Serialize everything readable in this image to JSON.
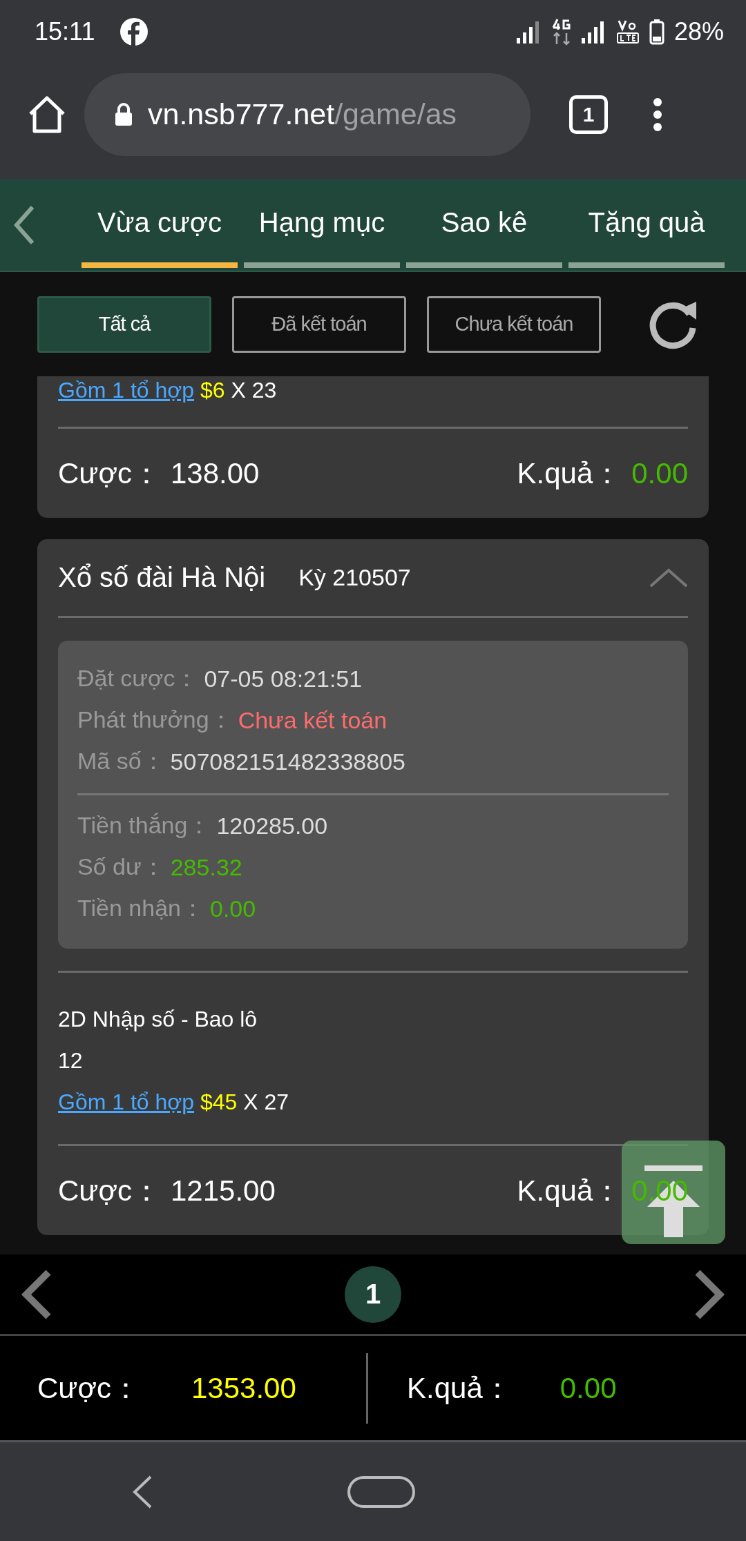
{
  "status_bar": {
    "time": "15:11",
    "battery": "28%"
  },
  "browser": {
    "url_host": "vn.nsb777.net",
    "url_path": "/game/as",
    "tab_count": "1"
  },
  "tabs": [
    {
      "label": "Vừa cược",
      "selected": true
    },
    {
      "label": "Hạng mục",
      "selected": false
    },
    {
      "label": "Sao kê",
      "selected": false
    },
    {
      "label": "Tặng quà",
      "selected": false
    }
  ],
  "filters": [
    {
      "label": "Tất cả",
      "selected": true
    },
    {
      "label": "Đã kết toán",
      "selected": false
    },
    {
      "label": "Chưa kết toán",
      "selected": false
    }
  ],
  "cards": [
    {
      "kind": "partial",
      "combo_link": "Gồm 1 tổ hợp",
      "stake": "$6",
      "multiplier": "X 23",
      "bet_label": "Cược：",
      "bet": "138.00",
      "result_label": "K.quả：",
      "result": "0.00"
    },
    {
      "kind": "full",
      "title": "Xổ số đài Hà Nội",
      "period": "Kỳ 210507",
      "expanded": true,
      "details": [
        [
          {
            "label": "Đặt cược：",
            "value": "07-05 08:21:51",
            "color": "#dddddd"
          },
          {
            "label": "Phát thưởng：",
            "value": "Chưa kết toán",
            "color": "#ff6b6b"
          },
          {
            "label": "Mã số：",
            "value": "507082151482338805",
            "color": "#dddddd"
          }
        ],
        [
          {
            "label": "Tiền thắng：",
            "value": "120285.00",
            "color": "#dddddd"
          },
          {
            "label": "Số dư：",
            "value": "285.32",
            "color": "#44bb00"
          },
          {
            "label": "Tiền nhận：",
            "value": "0.00",
            "color": "#44bb00"
          }
        ]
      ],
      "game": "2D Nhập số - Bao lô",
      "numbers": "12",
      "combo_link": "Gồm 1 tổ hợp",
      "stake": "$45",
      "multiplier": "X 27",
      "bet_label": "Cược：",
      "bet": "1215.00",
      "result_label": "K.quả：",
      "result": "0.00"
    }
  ],
  "pager": {
    "pages": [
      {
        "label": "1",
        "selected": true
      }
    ]
  },
  "totals": {
    "bet_label": "Cược：",
    "bet": "1353.00",
    "result_label": "K.quả：",
    "result": "0.00"
  }
}
